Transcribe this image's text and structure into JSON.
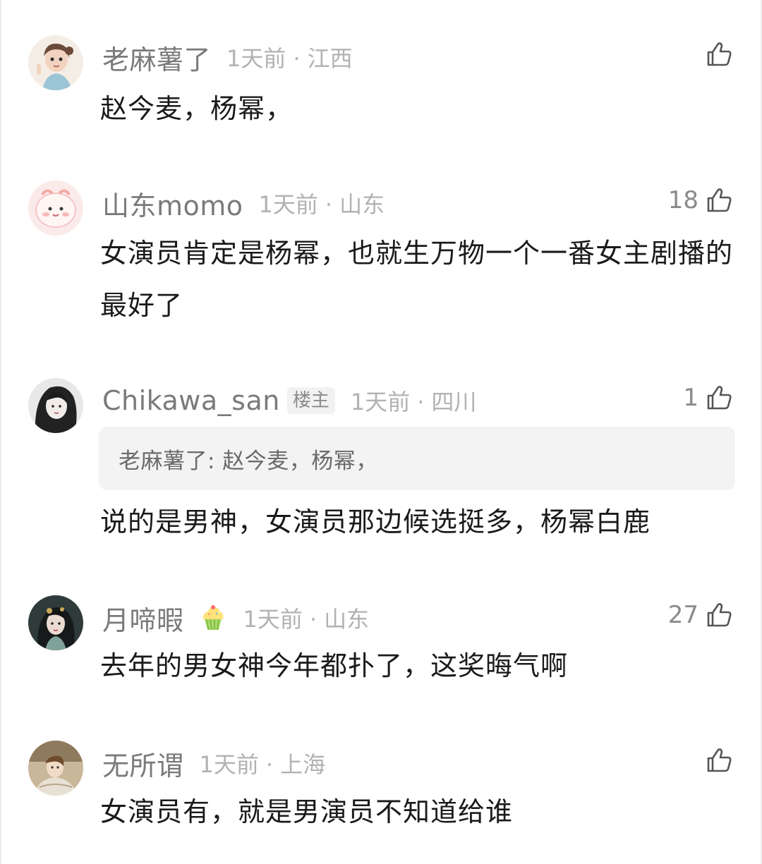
{
  "comments": [
    {
      "username": "老麻薯了",
      "time": "1天前",
      "location": "江西",
      "likes": "",
      "text": "赵今麦，杨幂，"
    },
    {
      "username": "山东momo",
      "time": "1天前",
      "location": "山东",
      "likes": "18",
      "text": "女演员肯定是杨幂，也就生万物一个一番女主剧播的最好了"
    },
    {
      "username": "Chikawa_san",
      "badge": "楼主",
      "time": "1天前",
      "location": "四川",
      "likes": "1",
      "quote": "老麻薯了: 赵今麦，杨幂，",
      "text": "说的是男神，女演员那边候选挺多，杨幂白鹿"
    },
    {
      "username": "月啼暇",
      "badge_icon": "cupcake-icon",
      "time": "1天前",
      "location": "山东",
      "likes": "27",
      "text": "去年的男女神今年都扑了，这奖晦气啊"
    },
    {
      "username": "无所谓",
      "time": "1天前",
      "location": "上海",
      "likes": "",
      "text": "女演员有，就是男演员不知道给谁"
    }
  ],
  "icons": {
    "like": "thumbs-up-icon"
  },
  "colors": {
    "username": "#7a7a7a",
    "meta": "#b2b2b2",
    "text": "#1a1a1a",
    "quote_bg": "#f3f3f3"
  }
}
